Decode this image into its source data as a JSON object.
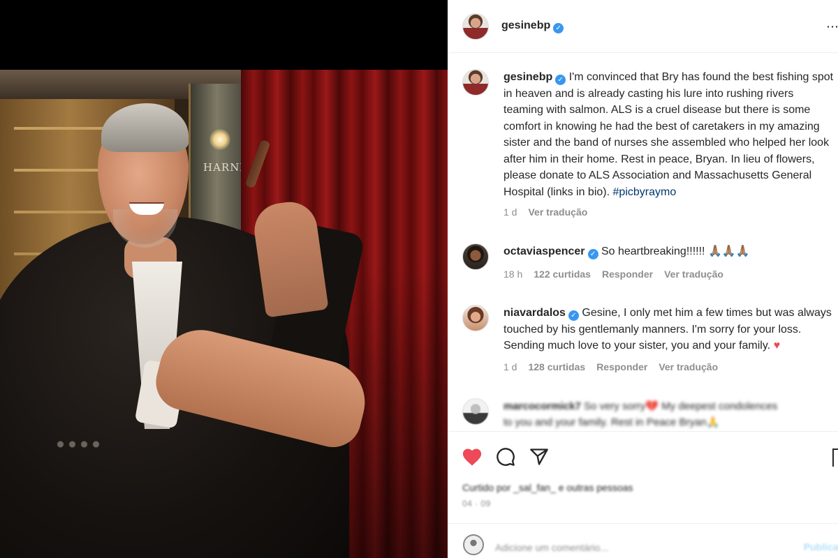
{
  "photo": {
    "sign_text": "HARNNO"
  },
  "post": {
    "username": "gesinebp",
    "more_icon": "⋯"
  },
  "caption": {
    "username": "gesinebp",
    "text": "I'm convinced that Bry has found the best fishing spot in heaven and is already casting his lure into rushing rivers teaming with salmon. ALS is a cruel disease but there is some comfort in knowing he had the best of caretakers in my amazing sister and the band of nurses she assembled who helped her look after him in their home. Rest in peace, Bryan. In lieu of flowers, please donate to ALS Association and Massachusetts General Hospital (links in bio).",
    "hashtag": "#picbyraymo",
    "time": "1 d",
    "translate": "Ver tradução"
  },
  "comments": [
    {
      "username": "octaviaspencer",
      "text": "So heartbreaking!!!!!! 🙏🏽🙏🏽🙏🏽",
      "time": "18 h",
      "likes": "122 curtidas",
      "reply": "Responder",
      "translate": "Ver tradução"
    },
    {
      "username": "niavardalos",
      "text": "Gesine, I only met him a few times but was always touched by his gentlemanly manners. I'm sorry for your loss. Sending much love to your sister, you and your family.",
      "heart": "♥",
      "time": "1 d",
      "likes": "128 curtidas",
      "reply": "Responder",
      "translate": "Ver tradução"
    },
    {
      "username": "marcocormick7",
      "line1": "So very sorry💔 My deepest condolences",
      "line2": "to you and your family. Rest in Peace Bryan🙏"
    }
  ],
  "actions": {
    "likes_text": "Curtido por _sal_fan_ e outras pessoas",
    "date": "04 · 09"
  },
  "add_comment": {
    "placeholder": "Adicione um comentário...",
    "publish": "Publicar"
  },
  "colors": {
    "heart": "#ed4956",
    "verified": "#3897f0",
    "hashtag": "#00376b",
    "muted": "#8e8e8e"
  }
}
